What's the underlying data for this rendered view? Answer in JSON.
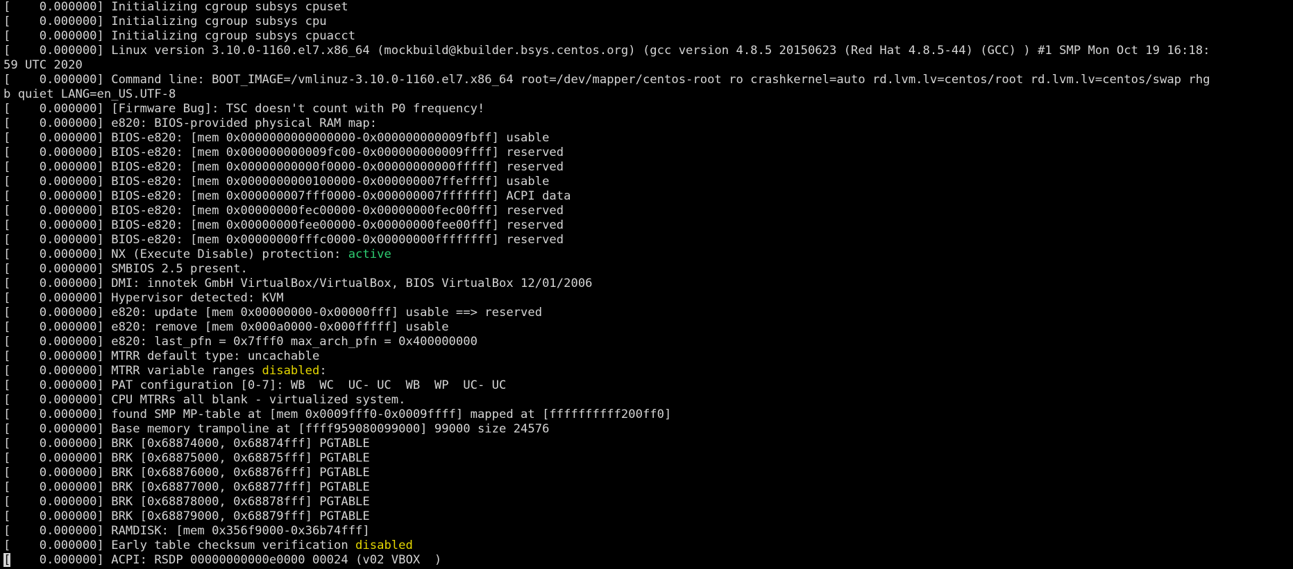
{
  "colors": {
    "background": "#000000",
    "text": "#d4d4d4",
    "active": "#2ecc71",
    "disabled": "#e5d700",
    "cursor": "#d4d4d4"
  },
  "cursor_char": "[",
  "lines": [
    {
      "segments": [
        {
          "text": "[    0.000000] Initializing cgroup subsys cpuset"
        }
      ]
    },
    {
      "segments": [
        {
          "text": "[    0.000000] Initializing cgroup subsys cpu"
        }
      ]
    },
    {
      "segments": [
        {
          "text": "[    0.000000] Initializing cgroup subsys cpuacct"
        }
      ]
    },
    {
      "segments": [
        {
          "text": "[    0.000000] Linux version 3.10.0-1160.el7.x86_64 (mockbuild@kbuilder.bsys.centos.org) (gcc version 4.8.5 20150623 (Red Hat 4.8.5-44) (GCC) ) #1 SMP Mon Oct 19 16:18:"
        }
      ]
    },
    {
      "segments": [
        {
          "text": "59 UTC 2020"
        }
      ]
    },
    {
      "segments": [
        {
          "text": "[    0.000000] Command line: BOOT_IMAGE=/vmlinuz-3.10.0-1160.el7.x86_64 root=/dev/mapper/centos-root ro crashkernel=auto rd.lvm.lv=centos/root rd.lvm.lv=centos/swap rhg"
        }
      ]
    },
    {
      "segments": [
        {
          "text": "b quiet LANG=en_US.UTF-8"
        }
      ]
    },
    {
      "segments": [
        {
          "text": "[    0.000000] [Firmware Bug]: TSC doesn't count with P0 frequency!"
        }
      ]
    },
    {
      "segments": [
        {
          "text": "[    0.000000] e820: BIOS-provided physical RAM map:"
        }
      ]
    },
    {
      "segments": [
        {
          "text": "[    0.000000] BIOS-e820: [mem 0x0000000000000000-0x000000000009fbff] usable"
        }
      ]
    },
    {
      "segments": [
        {
          "text": "[    0.000000] BIOS-e820: [mem 0x000000000009fc00-0x000000000009ffff] reserved"
        }
      ]
    },
    {
      "segments": [
        {
          "text": "[    0.000000] BIOS-e820: [mem 0x00000000000f0000-0x00000000000fffff] reserved"
        }
      ]
    },
    {
      "segments": [
        {
          "text": "[    0.000000] BIOS-e820: [mem 0x0000000000100000-0x000000007ffeffff] usable"
        }
      ]
    },
    {
      "segments": [
        {
          "text": "[    0.000000] BIOS-e820: [mem 0x000000007fff0000-0x000000007fffffff] ACPI data"
        }
      ]
    },
    {
      "segments": [
        {
          "text": "[    0.000000] BIOS-e820: [mem 0x00000000fec00000-0x00000000fec00fff] reserved"
        }
      ]
    },
    {
      "segments": [
        {
          "text": "[    0.000000] BIOS-e820: [mem 0x00000000fee00000-0x00000000fee00fff] reserved"
        }
      ]
    },
    {
      "segments": [
        {
          "text": "[    0.000000] BIOS-e820: [mem 0x00000000fffc0000-0x00000000ffffffff] reserved"
        }
      ]
    },
    {
      "segments": [
        {
          "text": "[    0.000000] NX (Execute Disable) protection: "
        },
        {
          "text": "active",
          "color": "#2ecc71"
        }
      ]
    },
    {
      "segments": [
        {
          "text": "[    0.000000] SMBIOS 2.5 present."
        }
      ]
    },
    {
      "segments": [
        {
          "text": "[    0.000000] DMI: innotek GmbH VirtualBox/VirtualBox, BIOS VirtualBox 12/01/2006"
        }
      ]
    },
    {
      "segments": [
        {
          "text": "[    0.000000] Hypervisor detected: KVM"
        }
      ]
    },
    {
      "segments": [
        {
          "text": "[    0.000000] e820: update [mem 0x00000000-0x00000fff] usable ==> reserved"
        }
      ]
    },
    {
      "segments": [
        {
          "text": "[    0.000000] e820: remove [mem 0x000a0000-0x000fffff] usable"
        }
      ]
    },
    {
      "segments": [
        {
          "text": "[    0.000000] e820: last_pfn = 0x7fff0 max_arch_pfn = 0x400000000"
        }
      ]
    },
    {
      "segments": [
        {
          "text": "[    0.000000] MTRR default type: uncachable"
        }
      ]
    },
    {
      "segments": [
        {
          "text": "[    0.000000] MTRR variable ranges "
        },
        {
          "text": "disabled",
          "color": "#e5d700"
        },
        {
          "text": ":"
        }
      ]
    },
    {
      "segments": [
        {
          "text": "[    0.000000] PAT configuration [0-7]: WB  WC  UC- UC  WB  WP  UC- UC"
        }
      ]
    },
    {
      "segments": [
        {
          "text": "[    0.000000] CPU MTRRs all blank - virtualized system."
        }
      ]
    },
    {
      "segments": [
        {
          "text": "[    0.000000] found SMP MP-table at [mem 0x0009fff0-0x0009ffff] mapped at [ffffffffff200ff0]"
        }
      ]
    },
    {
      "segments": [
        {
          "text": "[    0.000000] Base memory trampoline at [ffff959080099000] 99000 size 24576"
        }
      ]
    },
    {
      "segments": [
        {
          "text": "[    0.000000] BRK [0x68874000, 0x68874fff] PGTABLE"
        }
      ]
    },
    {
      "segments": [
        {
          "text": "[    0.000000] BRK [0x68875000, 0x68875fff] PGTABLE"
        }
      ]
    },
    {
      "segments": [
        {
          "text": "[    0.000000] BRK [0x68876000, 0x68876fff] PGTABLE"
        }
      ]
    },
    {
      "segments": [
        {
          "text": "[    0.000000] BRK [0x68877000, 0x68877fff] PGTABLE"
        }
      ]
    },
    {
      "segments": [
        {
          "text": "[    0.000000] BRK [0x68878000, 0x68878fff] PGTABLE"
        }
      ]
    },
    {
      "segments": [
        {
          "text": "[    0.000000] BRK [0x68879000, 0x68879fff] PGTABLE"
        }
      ]
    },
    {
      "segments": [
        {
          "text": "[    0.000000] RAMDISK: [mem 0x356f9000-0x36b74fff]"
        }
      ]
    },
    {
      "segments": [
        {
          "text": "[    0.000000] Early table checksum verification "
        },
        {
          "text": "disabled",
          "color": "#e5d700"
        }
      ]
    },
    {
      "segments": [
        {
          "cursor": true,
          "text": "["
        },
        {
          "text": "    0.000000] ACPI: RSDP 00000000000e0000 00024 (v02 VBOX  )"
        }
      ]
    }
  ]
}
